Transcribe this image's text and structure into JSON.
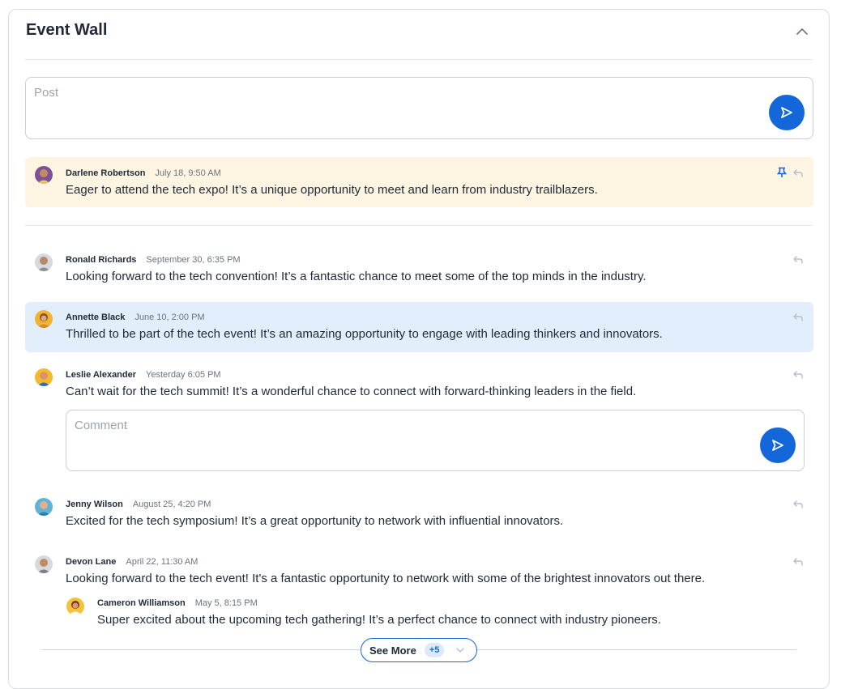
{
  "header": {
    "title": "Event Wall"
  },
  "post_input": {
    "placeholder": "Post"
  },
  "comment_input": {
    "placeholder": "Comment"
  },
  "pinned": {
    "name": "Darlene Robertson",
    "time": "July 18, 9:50 AM",
    "text": "Eager to attend the tech expo! It’s a unique opportunity to meet and learn from industry trailblazers."
  },
  "posts": [
    {
      "name": "Ronald Richards",
      "time": "September 30, 6:35 PM",
      "text": "Looking forward to the tech convention! It’s a fantastic chance to meet some of the top minds in the industry."
    },
    {
      "name": "Annette Black",
      "time": "June 10, 2:00 PM",
      "text": "Thrilled to be part of the tech event! It’s an amazing opportunity to engage with leading thinkers and innovators."
    },
    {
      "name": "Leslie Alexander",
      "time": "Yesterday 6:05 PM",
      "text": "Can’t wait for the tech summit! It’s a wonderful chance to connect with forward-thinking leaders in the field."
    },
    {
      "name": "Jenny Wilson",
      "time": "August 25, 4:20 PM",
      "text": "Excited for the tech symposium! It’s a great opportunity to network with influential innovators."
    },
    {
      "name": "Devon Lane",
      "time": "April 22, 11:30 AM",
      "text": "Looking forward to the tech event! It's a fantastic opportunity to network with some of the brightest innovators out there."
    }
  ],
  "reply": {
    "name": "Cameron Williamson",
    "time": "May 5, 8:15 PM",
    "text": "Super excited about the upcoming tech gathering! It’s a perfect chance to connect with industry pioneers."
  },
  "see_more": {
    "label": "See More",
    "count": "+5"
  },
  "colors": {
    "accent": "#1367d8",
    "pinned_bg": "#fdf5e2",
    "highlight_bg": "#e3eefc"
  }
}
